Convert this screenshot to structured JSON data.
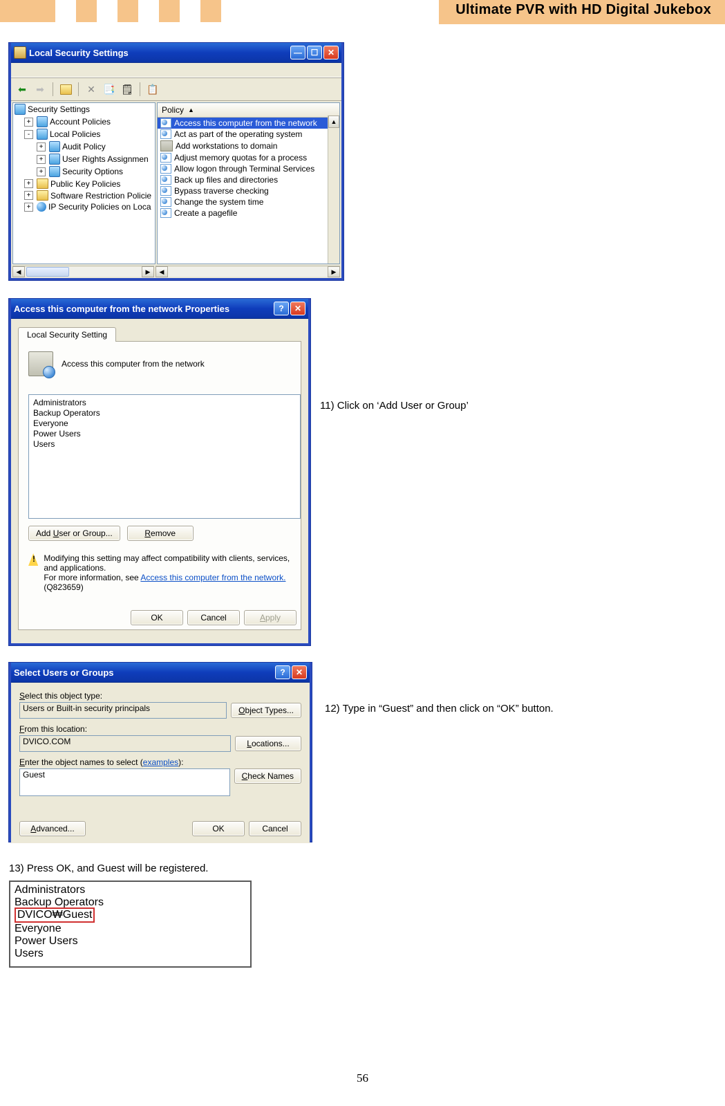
{
  "header": {
    "title": "Ultimate PVR with HD Digital Jukebox",
    "stripes": [
      "#f6c48a",
      "#ffffff",
      "#f6c48a",
      "#ffffff",
      "#f6c48a",
      "#ffffff",
      "#f6c48a",
      "#ffffff",
      "#f6c48a"
    ]
  },
  "instructions": {
    "step11": "11) Click on ‘Add User or Group’",
    "step12": "12) Type in “Guest” and then click on “OK” button.",
    "step13": "13) Press OK, and Guest will be registered."
  },
  "win1": {
    "title": "Local Security Settings",
    "list_header": "Policy",
    "tree": {
      "root": "Security Settings",
      "items": [
        {
          "exp": "+",
          "icon": "book",
          "label": "Account Policies"
        },
        {
          "exp": "-",
          "icon": "book",
          "label": "Local Policies",
          "children": [
            {
              "exp": "+",
              "icon": "book",
              "label": "Audit Policy"
            },
            {
              "exp": "+",
              "icon": "book",
              "label": "User Rights Assignmen",
              "selected": true
            },
            {
              "exp": "+",
              "icon": "book",
              "label": "Security Options"
            }
          ]
        },
        {
          "exp": "+",
          "icon": "folder",
          "label": "Public Key Policies"
        },
        {
          "exp": "+",
          "icon": "folder",
          "label": "Software Restriction Policie"
        },
        {
          "exp": "+",
          "icon": "globe",
          "label": "IP Security Policies on Loca"
        }
      ]
    },
    "policies": [
      {
        "icon": "policy",
        "label": "Access this computer from the network",
        "selected": true
      },
      {
        "icon": "policy",
        "label": "Act as part of the operating system"
      },
      {
        "icon": "pc",
        "label": "Add workstations to domain"
      },
      {
        "icon": "policy",
        "label": "Adjust memory quotas for a process"
      },
      {
        "icon": "policy",
        "label": "Allow logon through Terminal Services"
      },
      {
        "icon": "policy",
        "label": "Back up files and directories"
      },
      {
        "icon": "policy",
        "label": "Bypass traverse checking"
      },
      {
        "icon": "policy",
        "label": "Change the system time"
      },
      {
        "icon": "policy",
        "label": "Create a pagefile"
      }
    ]
  },
  "win2": {
    "title": "Access this computer from the network Properties",
    "tab": "Local Security Setting",
    "prop_label": "Access this computer from the network",
    "users": [
      "Administrators",
      "Backup Operators",
      "Everyone",
      "Power Users",
      "Users"
    ],
    "btn_add": "Add User or Group...",
    "btn_remove": "Remove",
    "warning_text_a": "Modifying this setting may affect compatibility with clients, services, and applications.",
    "warning_text_b": "For more information, see ",
    "warning_link": "Access this computer from the network.",
    "warning_kb": "(Q823659)",
    "btn_ok": "OK",
    "btn_cancel": "Cancel",
    "btn_apply": "Apply"
  },
  "win3": {
    "title": "Select Users or Groups",
    "lbl_type_a": "S",
    "lbl_type_b": "elect this object type:",
    "val_type": "Users or Built-in security principals",
    "btn_types_a": "O",
    "btn_types_b": "bject Types...",
    "lbl_loc_a": "F",
    "lbl_loc_b": "rom this location:",
    "val_loc": "DVICO.COM",
    "btn_loc_a": "L",
    "btn_loc_b": "ocations...",
    "lbl_names_a": "E",
    "lbl_names_b": "nter the object names to select (",
    "lbl_names_link": "examples",
    "lbl_names_c": "):",
    "val_names": "Guest",
    "btn_check_a": "C",
    "btn_check_b": "heck Names",
    "btn_adv_a": "A",
    "btn_adv_b": "dvanced...",
    "btn_ok": "OK",
    "btn_cancel": "Cancel"
  },
  "result": {
    "items": [
      "Administrators",
      "Backup Operators",
      "DVICO₩Guest",
      "Everyone",
      "Power Users",
      "Users"
    ],
    "highlight_index": 2
  },
  "page_number": "56"
}
